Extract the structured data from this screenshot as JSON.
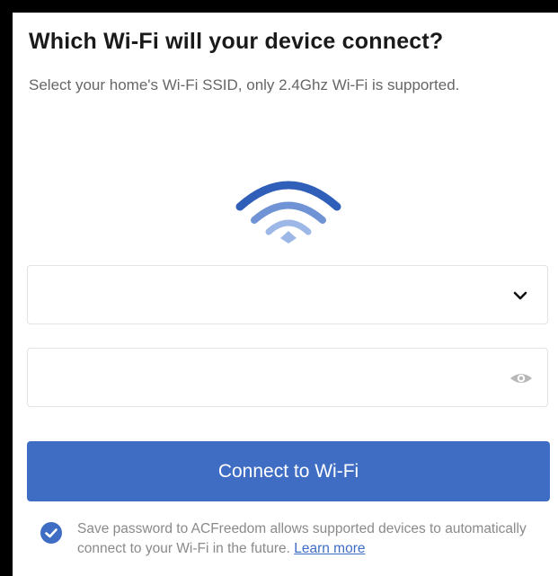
{
  "header": {
    "title": "Which Wi-Fi will your device connect?",
    "subtitle": "Select your home's Wi-Fi SSID,  only 2.4Ghz Wi-Fi is supported."
  },
  "icons": {
    "wifi": "wifi-icon",
    "dropdown": "chevron-down-icon",
    "visibility": "eye-icon",
    "checkbox": "check-circle-icon"
  },
  "form": {
    "ssid": {
      "value": ""
    },
    "password": {
      "value": ""
    }
  },
  "actions": {
    "connect_label": "Connect to Wi-Fi"
  },
  "save_option": {
    "checked": true,
    "text": "Save password to ACFreedom allows supported devices to automatically connect to your Wi-Fi in the future.",
    "link_label": "Learn more"
  },
  "colors": {
    "accent": "#3f6dc4",
    "wifi_dark": "#2f5fb8",
    "wifi_mid": "#6f93d4",
    "wifi_light": "#9db8e6",
    "text_primary": "#1a1a1a",
    "text_secondary": "#666666"
  }
}
